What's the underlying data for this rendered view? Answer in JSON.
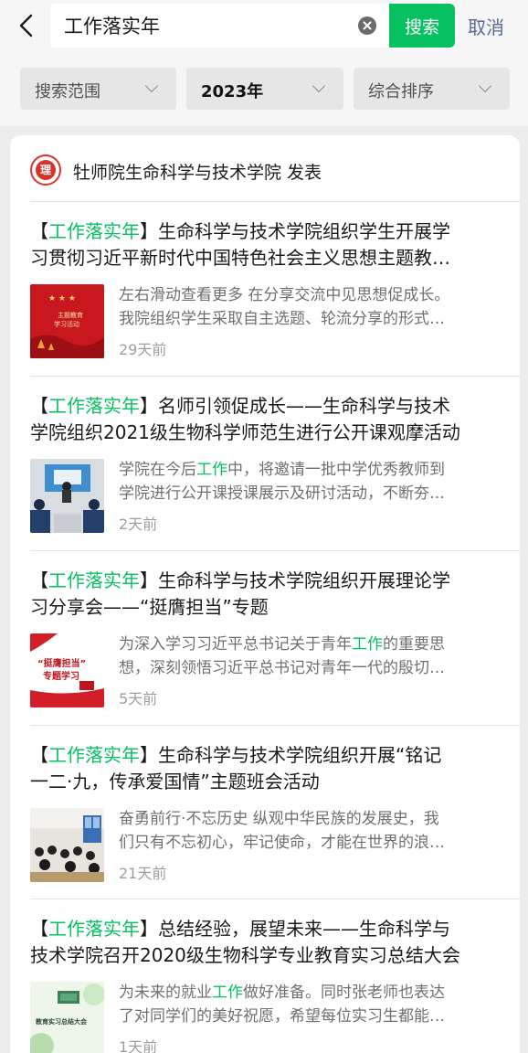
{
  "search": {
    "query": "工作落实年",
    "button_label": "搜索",
    "cancel_label": "取消"
  },
  "filters": [
    {
      "label": "搜索范围"
    },
    {
      "label": "2023年"
    },
    {
      "label": "综合排序"
    }
  ],
  "account": {
    "name": "牡师院生命科学与技术学院 发表"
  },
  "colors": {
    "accent": "#07c160",
    "link": "#576b95"
  },
  "results": [
    {
      "title_tag": "【",
      "keyword": "工作落实年",
      "title_tag_end": "】",
      "title_line1_rest": "生命科学与技术学院组织学生开展学",
      "title_line2": "习贯彻习近平新时代中国特色社会主义思想主题教…",
      "digest_line1": "左右滑动查看更多 在分享交流中见思想促成长。",
      "digest_line2": "我院组织学生采取自主选题、轮流分享的形式…",
      "time": "29天前",
      "thumb": {
        "line1": "主题教育",
        "line2": "学习活动"
      }
    },
    {
      "title_tag": "【",
      "keyword": "工作落实年",
      "title_tag_end": "】",
      "title_line1_rest": "名师引领促成长——生命科学与技术",
      "title_line2": "学院组织2021级生物科学师范生进行公开课观摩活动",
      "digest_line1_pre": "学院在今后",
      "digest_line1_hl": "工作",
      "digest_line1_post": "中，将邀请一批中学优秀教师到",
      "digest_line2": "学院进行公开课授课展示及研讨活动，不断夯…",
      "time": "2天前"
    },
    {
      "title_tag": "【",
      "keyword": "工作落实年",
      "title_tag_end": "】",
      "title_line1_rest": "生命科学与技术学院组织开展理论学",
      "title_line2": "习分享会——“挺膺担当”专题",
      "digest_line1_pre": "为深入学习习近平总书记关于青年",
      "digest_line1_hl": "工作",
      "digest_line1_post": "的重要思",
      "digest_line2": "想，深刻领悟习近平总书记对青年一代的殷切…",
      "time": "5天前",
      "thumb": {
        "line1": "“挺膺担当”",
        "line2": "专题学习"
      }
    },
    {
      "title_tag": "【",
      "keyword": "工作落实年",
      "title_tag_end": "】",
      "title_line1_rest": "生命科学与技术学院组织开展“铭记",
      "title_line2": "一二·九，传承爱国情”主题班会活动",
      "digest_line1": "奋勇前行·不忘历史 纵观中华民族的发展史，我",
      "digest_line2": "们只有不忘初心，牢记使命，才能在世界的浪…",
      "time": "21天前"
    },
    {
      "title_tag": "【",
      "keyword": "工作落实年",
      "title_tag_end": "】",
      "title_line1_rest": "总结经验，展望未来——生命科学与",
      "title_line2": "技术学院召开2020级生物科学专业教育实习总结大会",
      "digest_line1_pre": "为未来的就业",
      "digest_line1_hl": "工作",
      "digest_line1_post": "做好准备。同时张老师也表达",
      "digest_line2": "了对同学们的美好祝愿，希望每位实习生都能…",
      "time": "1天前",
      "thumb": {
        "line1": "教育实习总结大会"
      }
    }
  ]
}
